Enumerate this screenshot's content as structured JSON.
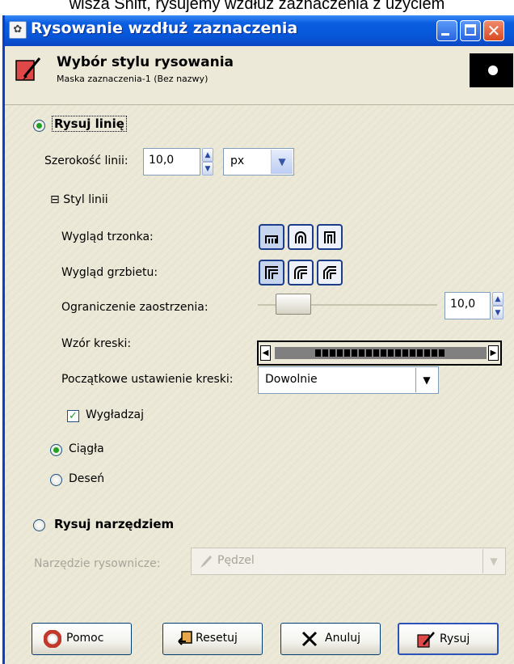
{
  "top_caption": "wisza Shift, rysujemy wzdłuż zaznaczenia z użyciem",
  "titlebar": {
    "title": "Rysowanie wzdłuż zaznaczenia"
  },
  "header": {
    "title": "Wybór stylu rysowania",
    "subtitle": "Maska zaznaczenia-1 (Bez nazwy)"
  },
  "stroke_line": {
    "label": "Rysuj linię",
    "width_label": "Szerokość linii:",
    "width_value": "10,0",
    "unit": "px",
    "style_expander": "Styl linii",
    "cap_label": "Wygląd trzonka:",
    "join_label": "Wygląd grzbietu:",
    "miter_label": "Ograniczenie zaostrzenia:",
    "miter_value": "10,0",
    "miter_level": 0.1,
    "dash_label": "Wzór kreski:",
    "dash_preset_label": "Początkowe ustawienie kreski:",
    "dash_preset_value": "Dowolnie",
    "antialias_label": "Wygładzaj",
    "solid_label": "Ciągła",
    "pattern_label": "Deseń"
  },
  "stroke_tool": {
    "label": "Rysuj narzędziem",
    "tool_label": "Narzędzie rysownicze:",
    "tool_value": "Pędzel"
  },
  "buttons": {
    "help": "Pomoc",
    "reset": "Resetuj",
    "cancel": "Anuluj",
    "stroke": "Rysuj"
  },
  "colors": {
    "titlebar": "#0856d8",
    "dialog_bg": "#ece9d8",
    "radio_dot": "#21a121"
  }
}
